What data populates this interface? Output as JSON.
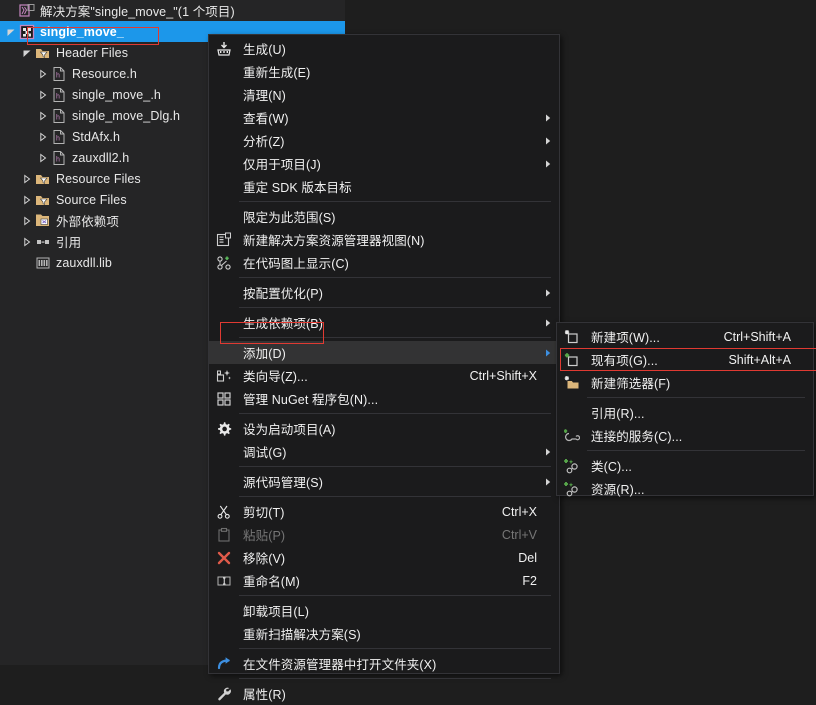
{
  "window": {
    "theme_bg": "#1e1e1e",
    "panel_bg": "#252526",
    "menu_bg": "#1b1b1c",
    "accent_selection": "#1c97ea",
    "annotation_color": "#e03a32"
  },
  "solution_explorer": {
    "items": [
      {
        "label": "解决方案\"single_move_\"(1 个项目)",
        "indent": 0,
        "icon": "solution-icon",
        "expander": "none",
        "selected": false
      },
      {
        "label": "single_move_",
        "indent": 0,
        "icon": "project-cpp-icon",
        "expander": "expanded",
        "selected": true
      },
      {
        "label": "Header Files",
        "indent": 1,
        "icon": "filter-folder-icon",
        "expander": "expanded",
        "selected": false
      },
      {
        "label": "Resource.h",
        "indent": 2,
        "icon": "header-file-icon",
        "expander": "collapsed",
        "selected": false
      },
      {
        "label": "single_move_.h",
        "indent": 2,
        "icon": "header-file-icon",
        "expander": "collapsed",
        "selected": false
      },
      {
        "label": "single_move_Dlg.h",
        "indent": 2,
        "icon": "header-file-icon",
        "expander": "collapsed",
        "selected": false
      },
      {
        "label": "StdAfx.h",
        "indent": 2,
        "icon": "header-file-icon",
        "expander": "collapsed",
        "selected": false
      },
      {
        "label": "zauxdll2.h",
        "indent": 2,
        "icon": "header-file-icon",
        "expander": "collapsed",
        "selected": false
      },
      {
        "label": "Resource Files",
        "indent": 1,
        "icon": "filter-folder-icon",
        "expander": "collapsed",
        "selected": false
      },
      {
        "label": "Source Files",
        "indent": 1,
        "icon": "filter-folder-icon",
        "expander": "collapsed",
        "selected": false
      },
      {
        "label": "外部依赖项",
        "indent": 1,
        "icon": "external-deps-icon",
        "expander": "collapsed",
        "selected": false
      },
      {
        "label": "引用",
        "indent": 1,
        "icon": "references-icon",
        "expander": "collapsed",
        "selected": false
      },
      {
        "label": "zauxdll.lib",
        "indent": 1,
        "icon": "library-icon",
        "expander": "none",
        "selected": false
      }
    ]
  },
  "context_menu": {
    "items": [
      {
        "type": "item",
        "label": "生成(U)",
        "shortcut": "",
        "icon": "build-icon",
        "arrow": false,
        "disabled": false,
        "highlight": false
      },
      {
        "type": "item",
        "label": "重新生成(E)",
        "shortcut": "",
        "icon": "",
        "arrow": false,
        "disabled": false,
        "highlight": false
      },
      {
        "type": "item",
        "label": "清理(N)",
        "shortcut": "",
        "icon": "",
        "arrow": false,
        "disabled": false,
        "highlight": false
      },
      {
        "type": "item",
        "label": "查看(W)",
        "shortcut": "",
        "icon": "",
        "arrow": true,
        "disabled": false,
        "highlight": false
      },
      {
        "type": "item",
        "label": "分析(Z)",
        "shortcut": "",
        "icon": "",
        "arrow": true,
        "disabled": false,
        "highlight": false
      },
      {
        "type": "item",
        "label": "仅用于项目(J)",
        "shortcut": "",
        "icon": "",
        "arrow": true,
        "disabled": false,
        "highlight": false
      },
      {
        "type": "item",
        "label": "重定 SDK 版本目标",
        "shortcut": "",
        "icon": "",
        "arrow": false,
        "disabled": false,
        "highlight": false
      },
      {
        "type": "separator"
      },
      {
        "type": "item",
        "label": "限定为此范围(S)",
        "shortcut": "",
        "icon": "",
        "arrow": false,
        "disabled": false,
        "highlight": false
      },
      {
        "type": "item",
        "label": "新建解决方案资源管理器视图(N)",
        "shortcut": "",
        "icon": "new-explorer-view-icon",
        "arrow": false,
        "disabled": false,
        "highlight": false
      },
      {
        "type": "item",
        "label": "在代码图上显示(C)",
        "shortcut": "",
        "icon": "code-map-icon",
        "arrow": false,
        "disabled": false,
        "highlight": false
      },
      {
        "type": "separator"
      },
      {
        "type": "item",
        "label": "按配置优化(P)",
        "shortcut": "",
        "icon": "",
        "arrow": true,
        "disabled": false,
        "highlight": false
      },
      {
        "type": "separator"
      },
      {
        "type": "item",
        "label": "生成依赖项(B)",
        "shortcut": "",
        "icon": "",
        "arrow": true,
        "disabled": false,
        "highlight": false
      },
      {
        "type": "separator"
      },
      {
        "type": "item",
        "label": "添加(D)",
        "shortcut": "",
        "icon": "",
        "arrow": true,
        "disabled": false,
        "highlight": true
      },
      {
        "type": "item",
        "label": "类向导(Z)...",
        "shortcut": "Ctrl+Shift+X",
        "icon": "class-wizard-icon",
        "arrow": false,
        "disabled": false,
        "highlight": false
      },
      {
        "type": "item",
        "label": "管理 NuGet 程序包(N)...",
        "shortcut": "",
        "icon": "nuget-icon",
        "arrow": false,
        "disabled": false,
        "highlight": false
      },
      {
        "type": "separator"
      },
      {
        "type": "item",
        "label": "设为启动项目(A)",
        "shortcut": "",
        "icon": "gear-icon",
        "arrow": false,
        "disabled": false,
        "highlight": false
      },
      {
        "type": "item",
        "label": "调试(G)",
        "shortcut": "",
        "icon": "",
        "arrow": true,
        "disabled": false,
        "highlight": false
      },
      {
        "type": "separator"
      },
      {
        "type": "item",
        "label": "源代码管理(S)",
        "shortcut": "",
        "icon": "",
        "arrow": true,
        "disabled": false,
        "highlight": false
      },
      {
        "type": "separator"
      },
      {
        "type": "item",
        "label": "剪切(T)",
        "shortcut": "Ctrl+X",
        "icon": "scissors-icon",
        "arrow": false,
        "disabled": false,
        "highlight": false
      },
      {
        "type": "item",
        "label": "粘贴(P)",
        "shortcut": "Ctrl+V",
        "icon": "paste-icon",
        "arrow": false,
        "disabled": true,
        "highlight": false
      },
      {
        "type": "item",
        "label": "移除(V)",
        "shortcut": "Del",
        "icon": "remove-x-icon",
        "arrow": false,
        "disabled": false,
        "highlight": false
      },
      {
        "type": "item",
        "label": "重命名(M)",
        "shortcut": "F2",
        "icon": "rename-icon",
        "arrow": false,
        "disabled": false,
        "highlight": false
      },
      {
        "type": "separator"
      },
      {
        "type": "item",
        "label": "卸载项目(L)",
        "shortcut": "",
        "icon": "",
        "arrow": false,
        "disabled": false,
        "highlight": false
      },
      {
        "type": "item",
        "label": "重新扫描解决方案(S)",
        "shortcut": "",
        "icon": "",
        "arrow": false,
        "disabled": false,
        "highlight": false
      },
      {
        "type": "separator"
      },
      {
        "type": "item",
        "label": "在文件资源管理器中打开文件夹(X)",
        "shortcut": "",
        "icon": "open-folder-arrow-icon",
        "arrow": false,
        "disabled": false,
        "highlight": false
      },
      {
        "type": "separator"
      },
      {
        "type": "item",
        "label": "属性(R)",
        "shortcut": "",
        "icon": "wrench-icon",
        "arrow": false,
        "disabled": false,
        "highlight": false
      }
    ]
  },
  "add_submenu": {
    "items": [
      {
        "type": "item",
        "label": "新建项(W)...",
        "shortcut": "Ctrl+Shift+A",
        "icon": "new-item-icon",
        "arrow": false,
        "disabled": false,
        "highlight": false
      },
      {
        "type": "item",
        "label": "现有项(G)...",
        "shortcut": "Shift+Alt+A",
        "icon": "existing-item-icon",
        "arrow": false,
        "disabled": false,
        "highlight": false
      },
      {
        "type": "item",
        "label": "新建筛选器(F)",
        "shortcut": "",
        "icon": "new-filter-icon",
        "arrow": false,
        "disabled": false,
        "highlight": false
      },
      {
        "type": "separator"
      },
      {
        "type": "item",
        "label": "引用(R)...",
        "shortcut": "",
        "icon": "",
        "arrow": false,
        "disabled": false,
        "highlight": false
      },
      {
        "type": "item",
        "label": "连接的服务(C)...",
        "shortcut": "",
        "icon": "connected-service-icon",
        "arrow": false,
        "disabled": false,
        "highlight": false
      },
      {
        "type": "separator"
      },
      {
        "type": "item",
        "label": "类(C)...",
        "shortcut": "",
        "icon": "add-class-icon",
        "arrow": false,
        "disabled": false,
        "highlight": false
      },
      {
        "type": "item",
        "label": "资源(R)...",
        "shortcut": "",
        "icon": "add-resource-icon",
        "arrow": false,
        "disabled": false,
        "highlight": false
      }
    ]
  },
  "annotations": [
    {
      "name": "project-node-outline",
      "target": "single_move_"
    },
    {
      "name": "add-menu-outline",
      "target": "添加(D)"
    },
    {
      "name": "existing-item-outline",
      "target": "现有项(G)..."
    }
  ]
}
